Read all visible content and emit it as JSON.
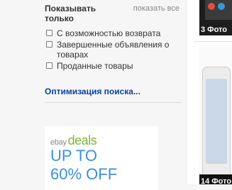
{
  "filter": {
    "title": "Показывать только",
    "show_all": "показать все",
    "options": [
      {
        "label": "С возможностью возврата",
        "checked": false
      },
      {
        "label": "Завершенные объявления о товарах",
        "checked": false
      },
      {
        "label": "Проданные товары",
        "checked": false
      }
    ]
  },
  "optimize_link": "Оптимизация поиска...",
  "ad": {
    "brand": "ebay",
    "brand_suffix": "deals",
    "line1": "UP TO",
    "line2": "60% OFF",
    "colors": {
      "deals": "#7bb53a",
      "headline": "#3c8ee0"
    }
  },
  "results": {
    "item1_caption": "3 Фото",
    "item2_caption": "14 Фото"
  },
  "colors": {
    "link": "#0a3fa3",
    "text": "#333333",
    "muted": "#888888"
  }
}
